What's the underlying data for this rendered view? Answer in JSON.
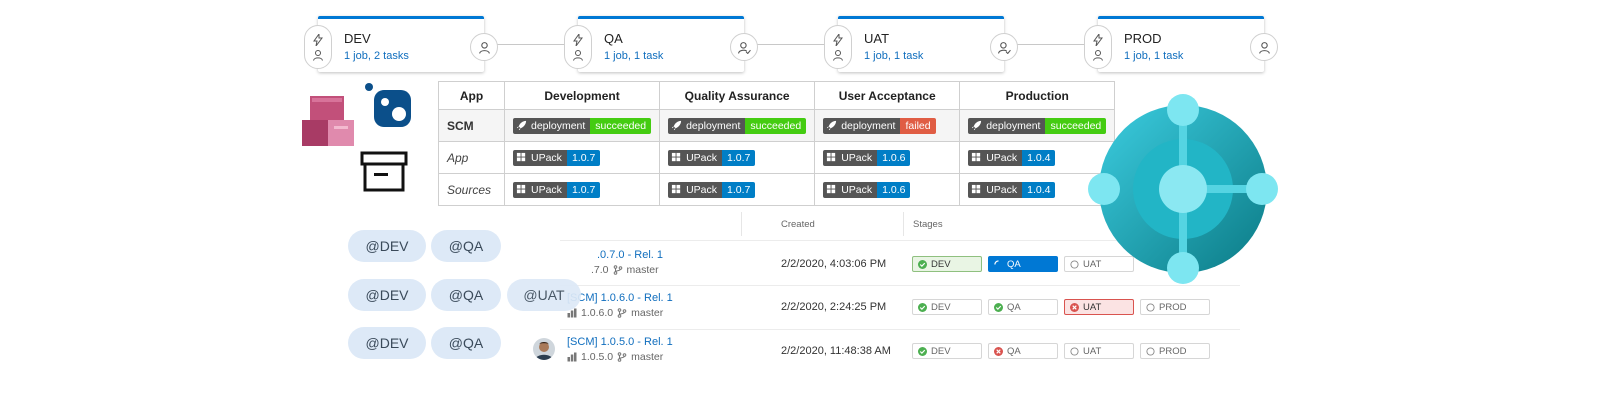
{
  "stages": [
    {
      "name": "DEV",
      "summary": "1 job, 2 tasks",
      "approver_icon": "person-icon"
    },
    {
      "name": "QA",
      "summary": "1 job, 1 task",
      "approver_icon": "person-check-icon"
    },
    {
      "name": "UAT",
      "summary": "1 job, 1 task",
      "approver_icon": "person-check-icon"
    },
    {
      "name": "PROD",
      "summary": "1 job, 1 task",
      "approver_icon": "person-icon"
    }
  ],
  "matrix": {
    "headers": [
      "App",
      "Development",
      "Quality Assurance",
      "User Acceptance",
      "Production"
    ],
    "rows": [
      {
        "label": "SCM",
        "cells": [
          {
            "label": "deployment",
            "value": "succeeded",
            "color": "#44cc11"
          },
          {
            "label": "deployment",
            "value": "succeeded",
            "color": "#44cc11"
          },
          {
            "label": "deployment",
            "value": "failed",
            "color": "#e05d44"
          },
          {
            "label": "deployment",
            "value": "succeeded",
            "color": "#44cc11"
          }
        ]
      },
      {
        "label": "App",
        "cells": [
          {
            "label": "UPack",
            "value": "1.0.7"
          },
          {
            "label": "UPack",
            "value": "1.0.7"
          },
          {
            "label": "UPack",
            "value": "1.0.6"
          },
          {
            "label": "UPack",
            "value": "1.0.4"
          }
        ]
      },
      {
        "label": "Sources",
        "cells": [
          {
            "label": "UPack",
            "value": "1.0.7"
          },
          {
            "label": "UPack",
            "value": "1.0.7"
          },
          {
            "label": "UPack",
            "value": "1.0.6"
          },
          {
            "label": "UPack",
            "value": "1.0.4"
          }
        ]
      }
    ]
  },
  "releases": {
    "headers": {
      "created": "Created",
      "stages": "Stages"
    },
    "items": [
      {
        "title": ".0.7.0 - Rel. 1",
        "version": ".7.0",
        "branch": "master",
        "created": "2/2/2020, 4:03:06 PM",
        "stages": [
          {
            "name": "DEV",
            "status": "success"
          },
          {
            "name": "QA",
            "status": "in-progress"
          },
          {
            "name": "UAT",
            "status": "pending"
          }
        ]
      },
      {
        "title": "[SCM] 1.0.6.0 - Rel. 1",
        "version": "1.0.6.0",
        "branch": "master",
        "created": "2/2/2020, 2:24:25 PM",
        "stages": [
          {
            "name": "DEV",
            "status": "success"
          },
          {
            "name": "QA",
            "status": "success"
          },
          {
            "name": "UAT",
            "status": "failed"
          },
          {
            "name": "PROD",
            "status": "pending"
          }
        ]
      },
      {
        "title": "[SCM] 1.0.5.0 - Rel. 1",
        "version": "1.0.5.0",
        "branch": "master",
        "created": "2/2/2020, 11:48:38 AM",
        "stages": [
          {
            "name": "DEV",
            "status": "success"
          },
          {
            "name": "QA",
            "status": "failed"
          },
          {
            "name": "UAT",
            "status": "pending"
          },
          {
            "name": "PROD",
            "status": "pending"
          }
        ]
      }
    ]
  },
  "chips": [
    [
      "@DEV",
      "@QA"
    ],
    [
      "@DEV",
      "@QA",
      "@UAT"
    ],
    [
      "@DEV",
      "@QA"
    ]
  ],
  "colors": {
    "accent": "#0078d4",
    "success": "#44cc11",
    "failed": "#e05d44",
    "version": "#007ec6",
    "chip_bg": "#dde9f7"
  }
}
